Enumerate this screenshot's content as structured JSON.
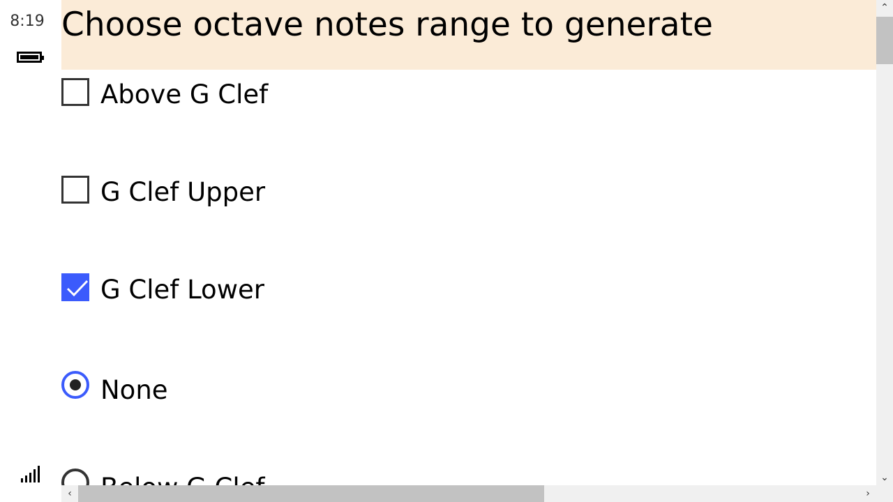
{
  "status_bar": {
    "time": "8:19",
    "battery_icon": "battery-full-icon",
    "signal_icon": "signal-strength-icon"
  },
  "header": {
    "title": "Choose octave notes range to generate",
    "background": "#fbebd7"
  },
  "options": [
    {
      "type": "checkbox",
      "label": "Above G Clef",
      "checked": false
    },
    {
      "type": "checkbox",
      "label": "G Clef Upper",
      "checked": false
    },
    {
      "type": "checkbox",
      "label": "G Clef Lower",
      "checked": true
    },
    {
      "type": "radio",
      "label": "None",
      "selected": true
    },
    {
      "type": "radio",
      "label": "Below G Clef",
      "selected": false
    }
  ],
  "colors": {
    "accent": "#3b5bfc",
    "scrollbar_track": "#f0f0f0",
    "scrollbar_thumb": "#c2c2c2"
  },
  "scrollbars": {
    "vertical_up_icon": "chevron-up-icon",
    "vertical_down_icon": "chevron-down-icon",
    "horizontal_left_icon": "chevron-left-icon",
    "horizontal_right_icon": "chevron-right-icon"
  }
}
